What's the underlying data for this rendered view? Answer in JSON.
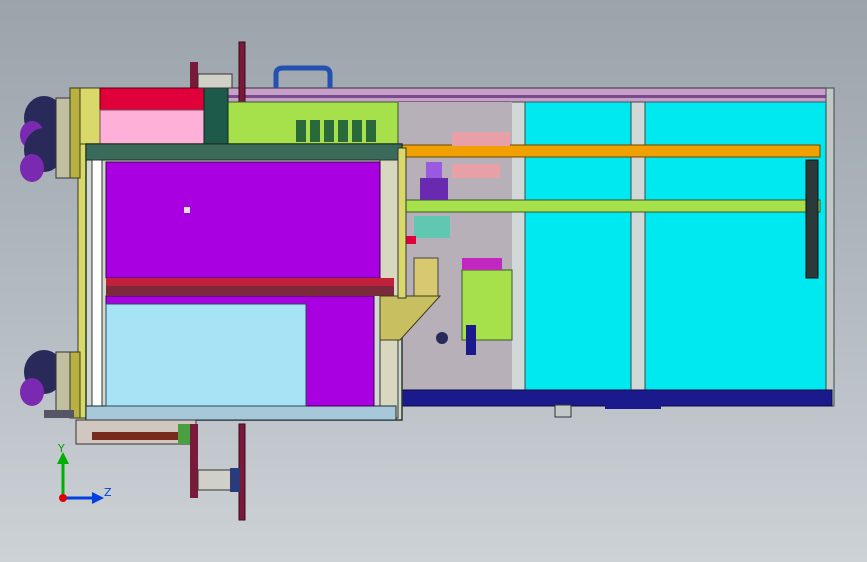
{
  "viewport": {
    "background_top": "#9ba3ab",
    "background_bottom": "#cdd2d6"
  },
  "model": {
    "colors": {
      "frame_yellow": "#d9d96a",
      "magenta": "#a800e0",
      "cyan": "#00e8f0",
      "light_blue": "#a6e3f5",
      "pink": "#ffb0d8",
      "red": "#e0003a",
      "navy": "#1a1a8c",
      "orange": "#f0a000",
      "green_rail": "#a6e04a",
      "dark_green": "#1e5a4a",
      "olive": "#b8b040",
      "purple_dark": "#5a1a7a",
      "maroon": "#7a1a3a"
    }
  },
  "triad": {
    "y_label": "Y",
    "z_label": "Z",
    "x_dot_color": "#e00000",
    "y_color": "#00b000",
    "z_color": "#0040e0"
  }
}
